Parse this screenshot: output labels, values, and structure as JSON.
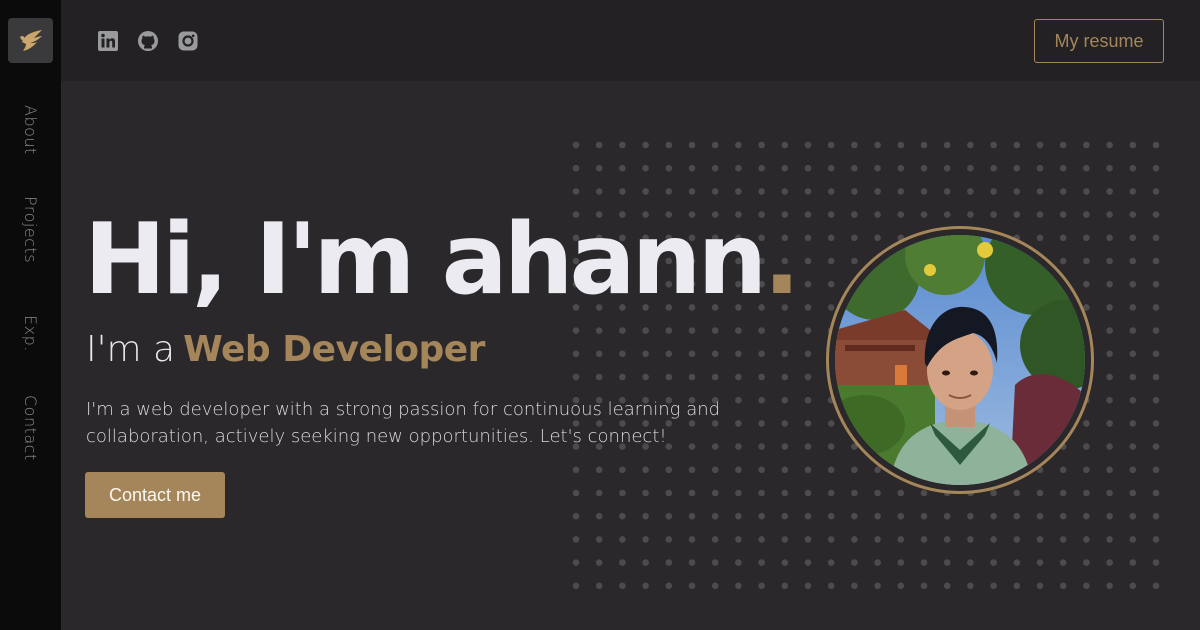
{
  "sidebar": {
    "logo_icon": "wing-logo-icon",
    "items": [
      {
        "label": "About"
      },
      {
        "label": "Projects"
      },
      {
        "label": "Exp."
      },
      {
        "label": "Contact"
      }
    ]
  },
  "topbar": {
    "social": [
      {
        "icon": "linkedin-icon"
      },
      {
        "icon": "github-icon"
      },
      {
        "icon": "instagram-icon"
      }
    ],
    "resume_label": "My resume"
  },
  "hero": {
    "greeting": "Hi, I'm ahann",
    "greeting_dot": ".",
    "subtitle_prefix": "I'm a",
    "role": "Web Developer",
    "bio": "I'm a web developer with a strong passion for continuous learning and collaboration, actively seeking new opportunities. Let's connect!",
    "contact_label": "Contact me"
  },
  "colors": {
    "accent": "#a5865a",
    "background": "#2a282a",
    "sidebar": "#0b0b0b",
    "topbar": "#232123",
    "text": "#ecebf2"
  }
}
